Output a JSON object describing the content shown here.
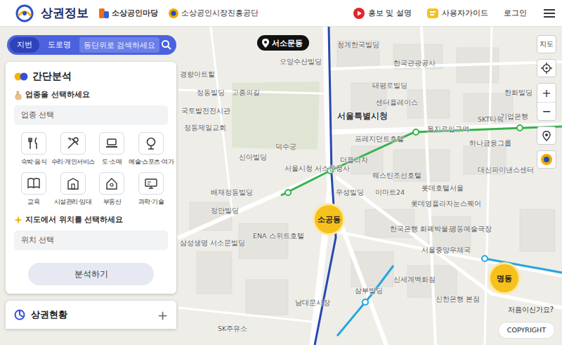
{
  "header": {
    "title": "상권정보",
    "partners": [
      "소상공인마당",
      "소상공인시장진흥공단"
    ],
    "links": [
      "홍보 및 설명",
      "사용자가이드",
      "로그인"
    ]
  },
  "search": {
    "tabs": [
      {
        "label": "지번",
        "selected": true
      },
      {
        "label": "도로명",
        "selected": false
      }
    ],
    "placeholder": "동단위로 검색하세요"
  },
  "location_badge": "서소문동",
  "analysis": {
    "title": "간단분석",
    "industry_prompt": "업종을 선택하세요",
    "industry_field": "업종 선택",
    "categories": [
      "숙박·음식",
      "수리·개인서비스",
      "도·소매",
      "예술·스포츠·여가",
      "교육",
      "시설관리·임대",
      "부동산",
      "과학·기술"
    ],
    "location_prompt": "지도에서 위치를 선택하세요",
    "location_field": "위치 선택",
    "submit": "분석하기"
  },
  "status_panel": {
    "title": "상권현황",
    "toggle": "+"
  },
  "map_controls": {
    "map_type": "지도",
    "zoom_in": "+",
    "zoom_out": "−"
  },
  "clusters": [
    "소공동",
    "명동"
  ],
  "map_labels": [
    "경향아트힐",
    "정동빌딩",
    "고종의길",
    "국토발전전시관",
    "오양수산빌딩",
    "청계한국빌딩",
    "한국관광공사",
    "태평로빌딩",
    "센터플레이스",
    "서울특별시청",
    "덕수궁",
    "신아빌딩",
    "서울시청 서소문청사",
    "더플라자",
    "웨스틴조선호텔",
    "프레지던트호텔",
    "하나금융그룹",
    "SKT타워",
    "한화빌딩",
    "기업은행",
    "대신파이낸스센터",
    "롯데영플라자",
    "눈스퀘어",
    "이마트24",
    "우성빌딩",
    "배재정동빌딩",
    "정안빌딩",
    "삼성생명 서소문빌딩",
    "ENA 스위트호텔",
    "한국은행 화폐박물관",
    "서울중앙우체국",
    "신세계백화점",
    "삼부빌딩",
    "남대문시장",
    "SK주유소",
    "롯데호텔서울",
    "을지로입구역",
    "명동예술극장",
    "신한은행 본점",
    "정동제일교회"
  ],
  "help": "처음이신가요?",
  "copyright": "COPYRIGHT"
}
